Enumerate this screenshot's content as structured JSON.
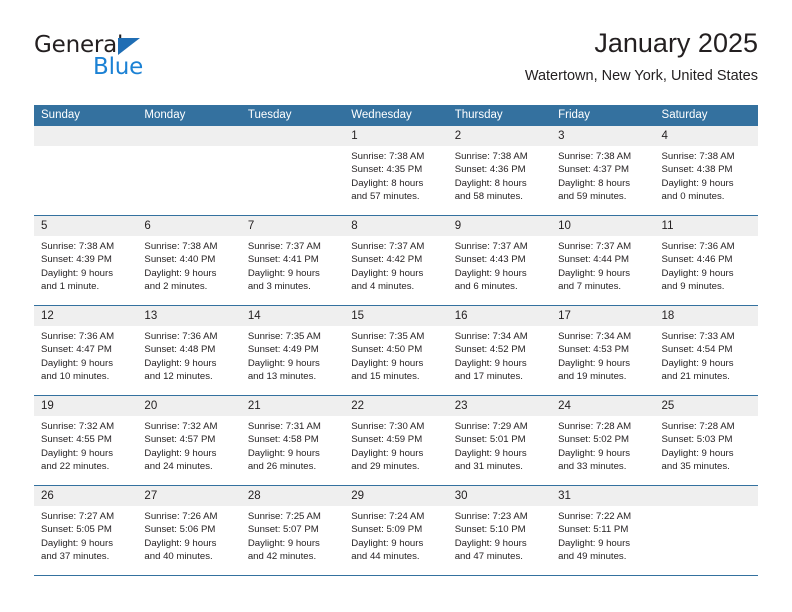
{
  "brand": {
    "name_top": "General",
    "name_bottom": "Blue",
    "triangle_icon": "blue-triangle-icon",
    "color_top": "#231f20",
    "color_bottom": "#1b81d4",
    "accent": "#1f6db4"
  },
  "header": {
    "title": "January 2025",
    "subtitle": "Watertown, New York, United States"
  },
  "theme": {
    "header_row_bg": "#34719f",
    "header_row_text": "#ffffff",
    "day_band_bg": "#efefef",
    "row_separator": "#34719f",
    "text": "#231f20"
  },
  "calendar": {
    "weekdays": [
      "Sunday",
      "Monday",
      "Tuesday",
      "Wednesday",
      "Thursday",
      "Friday",
      "Saturday"
    ],
    "weeks": [
      [
        {
          "day": "",
          "lines": []
        },
        {
          "day": "",
          "lines": []
        },
        {
          "day": "",
          "lines": []
        },
        {
          "day": "1",
          "lines": [
            "Sunrise: 7:38 AM",
            "Sunset: 4:35 PM",
            "Daylight: 8 hours",
            "and 57 minutes."
          ]
        },
        {
          "day": "2",
          "lines": [
            "Sunrise: 7:38 AM",
            "Sunset: 4:36 PM",
            "Daylight: 8 hours",
            "and 58 minutes."
          ]
        },
        {
          "day": "3",
          "lines": [
            "Sunrise: 7:38 AM",
            "Sunset: 4:37 PM",
            "Daylight: 8 hours",
            "and 59 minutes."
          ]
        },
        {
          "day": "4",
          "lines": [
            "Sunrise: 7:38 AM",
            "Sunset: 4:38 PM",
            "Daylight: 9 hours",
            "and 0 minutes."
          ]
        }
      ],
      [
        {
          "day": "5",
          "lines": [
            "Sunrise: 7:38 AM",
            "Sunset: 4:39 PM",
            "Daylight: 9 hours",
            "and 1 minute."
          ]
        },
        {
          "day": "6",
          "lines": [
            "Sunrise: 7:38 AM",
            "Sunset: 4:40 PM",
            "Daylight: 9 hours",
            "and 2 minutes."
          ]
        },
        {
          "day": "7",
          "lines": [
            "Sunrise: 7:37 AM",
            "Sunset: 4:41 PM",
            "Daylight: 9 hours",
            "and 3 minutes."
          ]
        },
        {
          "day": "8",
          "lines": [
            "Sunrise: 7:37 AM",
            "Sunset: 4:42 PM",
            "Daylight: 9 hours",
            "and 4 minutes."
          ]
        },
        {
          "day": "9",
          "lines": [
            "Sunrise: 7:37 AM",
            "Sunset: 4:43 PM",
            "Daylight: 9 hours",
            "and 6 minutes."
          ]
        },
        {
          "day": "10",
          "lines": [
            "Sunrise: 7:37 AM",
            "Sunset: 4:44 PM",
            "Daylight: 9 hours",
            "and 7 minutes."
          ]
        },
        {
          "day": "11",
          "lines": [
            "Sunrise: 7:36 AM",
            "Sunset: 4:46 PM",
            "Daylight: 9 hours",
            "and 9 minutes."
          ]
        }
      ],
      [
        {
          "day": "12",
          "lines": [
            "Sunrise: 7:36 AM",
            "Sunset: 4:47 PM",
            "Daylight: 9 hours",
            "and 10 minutes."
          ]
        },
        {
          "day": "13",
          "lines": [
            "Sunrise: 7:36 AM",
            "Sunset: 4:48 PM",
            "Daylight: 9 hours",
            "and 12 minutes."
          ]
        },
        {
          "day": "14",
          "lines": [
            "Sunrise: 7:35 AM",
            "Sunset: 4:49 PM",
            "Daylight: 9 hours",
            "and 13 minutes."
          ]
        },
        {
          "day": "15",
          "lines": [
            "Sunrise: 7:35 AM",
            "Sunset: 4:50 PM",
            "Daylight: 9 hours",
            "and 15 minutes."
          ]
        },
        {
          "day": "16",
          "lines": [
            "Sunrise: 7:34 AM",
            "Sunset: 4:52 PM",
            "Daylight: 9 hours",
            "and 17 minutes."
          ]
        },
        {
          "day": "17",
          "lines": [
            "Sunrise: 7:34 AM",
            "Sunset: 4:53 PM",
            "Daylight: 9 hours",
            "and 19 minutes."
          ]
        },
        {
          "day": "18",
          "lines": [
            "Sunrise: 7:33 AM",
            "Sunset: 4:54 PM",
            "Daylight: 9 hours",
            "and 21 minutes."
          ]
        }
      ],
      [
        {
          "day": "19",
          "lines": [
            "Sunrise: 7:32 AM",
            "Sunset: 4:55 PM",
            "Daylight: 9 hours",
            "and 22 minutes."
          ]
        },
        {
          "day": "20",
          "lines": [
            "Sunrise: 7:32 AM",
            "Sunset: 4:57 PM",
            "Daylight: 9 hours",
            "and 24 minutes."
          ]
        },
        {
          "day": "21",
          "lines": [
            "Sunrise: 7:31 AM",
            "Sunset: 4:58 PM",
            "Daylight: 9 hours",
            "and 26 minutes."
          ]
        },
        {
          "day": "22",
          "lines": [
            "Sunrise: 7:30 AM",
            "Sunset: 4:59 PM",
            "Daylight: 9 hours",
            "and 29 minutes."
          ]
        },
        {
          "day": "23",
          "lines": [
            "Sunrise: 7:29 AM",
            "Sunset: 5:01 PM",
            "Daylight: 9 hours",
            "and 31 minutes."
          ]
        },
        {
          "day": "24",
          "lines": [
            "Sunrise: 7:28 AM",
            "Sunset: 5:02 PM",
            "Daylight: 9 hours",
            "and 33 minutes."
          ]
        },
        {
          "day": "25",
          "lines": [
            "Sunrise: 7:28 AM",
            "Sunset: 5:03 PM",
            "Daylight: 9 hours",
            "and 35 minutes."
          ]
        }
      ],
      [
        {
          "day": "26",
          "lines": [
            "Sunrise: 7:27 AM",
            "Sunset: 5:05 PM",
            "Daylight: 9 hours",
            "and 37 minutes."
          ]
        },
        {
          "day": "27",
          "lines": [
            "Sunrise: 7:26 AM",
            "Sunset: 5:06 PM",
            "Daylight: 9 hours",
            "and 40 minutes."
          ]
        },
        {
          "day": "28",
          "lines": [
            "Sunrise: 7:25 AM",
            "Sunset: 5:07 PM",
            "Daylight: 9 hours",
            "and 42 minutes."
          ]
        },
        {
          "day": "29",
          "lines": [
            "Sunrise: 7:24 AM",
            "Sunset: 5:09 PM",
            "Daylight: 9 hours",
            "and 44 minutes."
          ]
        },
        {
          "day": "30",
          "lines": [
            "Sunrise: 7:23 AM",
            "Sunset: 5:10 PM",
            "Daylight: 9 hours",
            "and 47 minutes."
          ]
        },
        {
          "day": "31",
          "lines": [
            "Sunrise: 7:22 AM",
            "Sunset: 5:11 PM",
            "Daylight: 9 hours",
            "and 49 minutes."
          ]
        },
        {
          "day": "",
          "lines": []
        }
      ]
    ]
  }
}
